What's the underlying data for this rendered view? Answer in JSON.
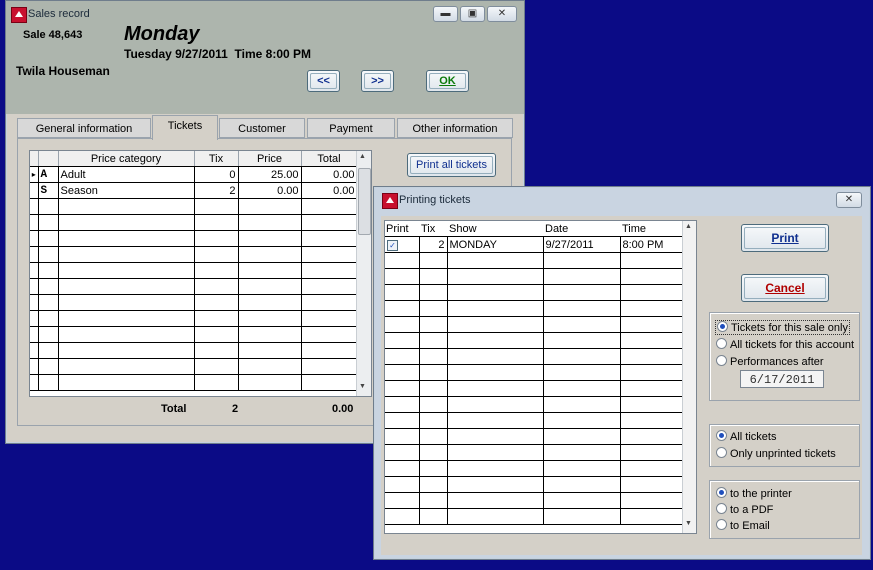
{
  "sales": {
    "title": "Sales record",
    "sale_label": "Sale 48,643",
    "day": "Monday",
    "datetime": "Tuesday 9/27/2011  Time 8:00 PM",
    "customer": "Twila Houseman",
    "prev_label": "<<",
    "next_label": ">>",
    "ok_label": "OK",
    "tabs": [
      "General information",
      "Tickets",
      "Customer",
      "Payment",
      "Other information"
    ],
    "print_all_label": "Print all tickets",
    "columns": [
      "Price category",
      "Tix",
      "Price",
      "Total"
    ],
    "rows": [
      {
        "marker": "▸",
        "code": "A",
        "category": "Adult",
        "tix": "0",
        "price": "25.00",
        "total": "0.00"
      },
      {
        "marker": "",
        "code": "S",
        "category": "Season",
        "tix": "2",
        "price": "0.00",
        "total": "0.00"
      }
    ],
    "total_label": "Total",
    "total_tix": "2",
    "total_amount": "0.00"
  },
  "printing": {
    "title": "Printing tickets",
    "columns": [
      "Print",
      "Tix",
      "Show",
      "Date",
      "Time"
    ],
    "rows": [
      {
        "print": true,
        "tix": "2",
        "show": "MONDAY",
        "date": "9/27/2011",
        "time": "8:00 PM"
      }
    ],
    "print_label": "Print",
    "cancel_label": "Cancel",
    "scope_options": [
      "Tickets for this sale only",
      "All tickets for this account",
      "Performances after"
    ],
    "scope_selected": 0,
    "after_date": "6/17/2011",
    "filter_options": [
      "All tickets",
      "Only unprinted tickets"
    ],
    "filter_selected": 0,
    "dest_options": [
      "to the printer",
      "to a PDF",
      "to Email"
    ],
    "dest_selected": 0
  },
  "colors": {
    "desktop": "#0b0b86",
    "window_face": "#d4d0c8",
    "header_face": "#adb5ad",
    "ok_green": "#0a7a0a",
    "cancel_red": "#b00000",
    "print_blue": "#0f2f8f"
  },
  "icons": [
    "app-icon",
    "minimize-icon",
    "maximize-icon",
    "close-icon",
    "row-pointer-icon",
    "checkbox-icon",
    "scroll-up-arrow-icon",
    "scroll-down-arrow-icon"
  ]
}
